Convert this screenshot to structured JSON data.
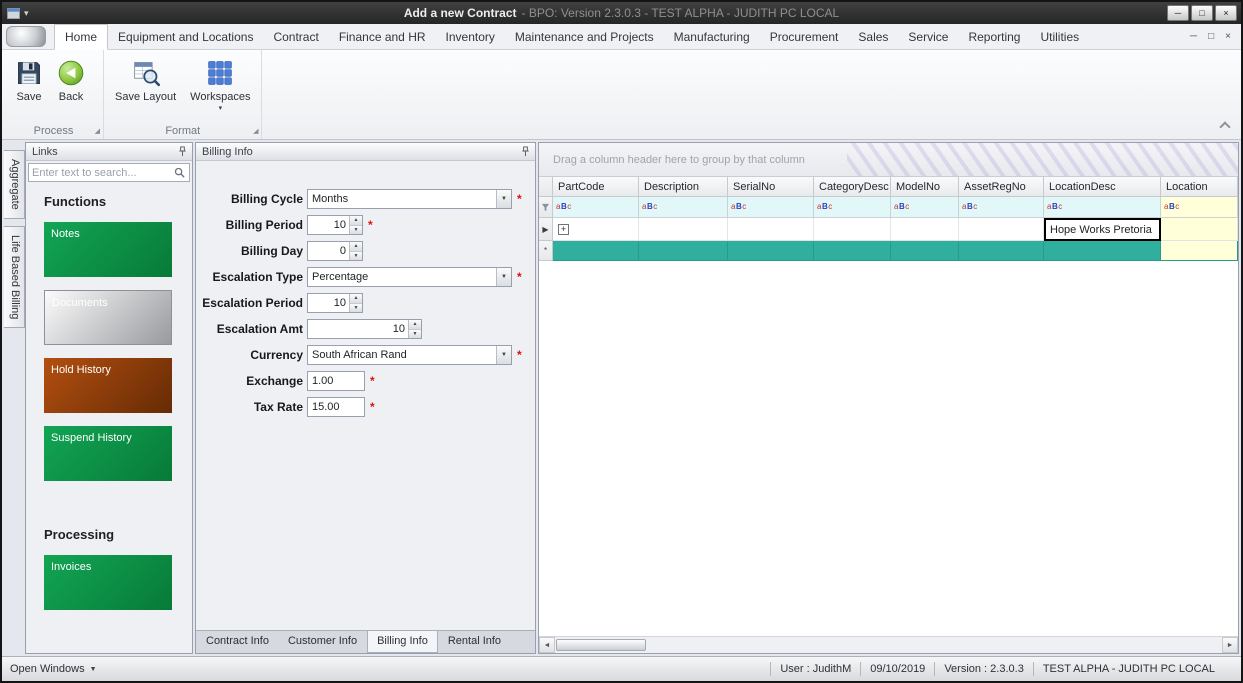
{
  "titlebar": {
    "title": "Add a new Contract",
    "subtitle": "- BPO: Version 2.3.0.3 - TEST ALPHA - JUDITH PC LOCAL"
  },
  "ribbon": {
    "tabs": [
      "Home",
      "Equipment and Locations",
      "Contract",
      "Finance and HR",
      "Inventory",
      "Maintenance and Projects",
      "Manufacturing",
      "Procurement",
      "Sales",
      "Service",
      "Reporting",
      "Utilities"
    ],
    "active_tab": "Home",
    "buttons": {
      "save": "Save",
      "back": "Back",
      "save_layout": "Save Layout",
      "workspaces": "Workspaces"
    },
    "groups": {
      "process": "Process",
      "format": "Format"
    }
  },
  "dock_tabs": [
    "Aggregate",
    "Life Based Billing"
  ],
  "links": {
    "title": "Links",
    "search_placeholder": "Enter text to search...",
    "functions_heading": "Functions",
    "processing_heading": "Processing",
    "function_buttons": [
      {
        "label": "Notes"
      },
      {
        "label": "Documents"
      },
      {
        "label": "Hold History"
      },
      {
        "label": "Suspend History"
      }
    ],
    "processing_buttons": [
      {
        "label": "Invoices"
      }
    ]
  },
  "billing": {
    "title": "Billing Info",
    "required_marker": "*",
    "fields": {
      "billing_cycle": {
        "label": "Billing Cycle",
        "value": "Months"
      },
      "billing_period": {
        "label": "Billing Period",
        "value": "10"
      },
      "billing_day": {
        "label": "Billing Day",
        "value": "0"
      },
      "escalation_type": {
        "label": "Escalation Type",
        "value": "Percentage"
      },
      "escalation_period": {
        "label": "Escalation Period",
        "value": "10"
      },
      "escalation_amt": {
        "label": "Escalation Amt",
        "value": "10"
      },
      "currency": {
        "label": "Currency",
        "value": "South African Rand"
      },
      "exchange": {
        "label": "Exchange",
        "value": "1.00"
      },
      "tax_rate": {
        "label": "Tax Rate",
        "value": "15.00"
      }
    },
    "tabs": [
      "Contract Info",
      "Customer Info",
      "Billing Info",
      "Rental Info"
    ],
    "active_tab": "Billing Info"
  },
  "grid": {
    "group_hint": "Drag a column header here to group by that column",
    "columns": [
      "PartCode",
      "Description",
      "SerialNo",
      "CategoryDesc",
      "ModelNo",
      "AssetRegNo",
      "LocationDesc",
      "Location"
    ],
    "filter_glyph": {
      "a": "a",
      "b": "B",
      "c": "c"
    },
    "focused_cell_value": "Hope Works Pretoria"
  },
  "statusbar": {
    "open_windows": "Open Windows",
    "user": "User : JudithM",
    "date": "09/10/2019",
    "version": "Version : 2.3.0.3",
    "environment": "TEST ALPHA - JUDITH PC LOCAL"
  },
  "icons": {
    "qat_caret": "▾",
    "minimize": "─",
    "restore": "□",
    "close": "×",
    "dropdown": "▼",
    "spin_up": "▲",
    "spin_down": "▼",
    "workspaces_caret": "▾",
    "launcher": "◢",
    "row_arrow": "▶",
    "expand_plus": "+",
    "new_row_star": "*",
    "open_windows_caret": "▼",
    "scroll_left": "◄",
    "scroll_right": "►"
  },
  "colors": {
    "green_light": "#12a554",
    "green_dark": "#077a38",
    "silver_light": "#fbfbfb",
    "silver_dark": "#989a9e",
    "red_light": "#b34f10",
    "red_dark": "#662b05",
    "new_row_teal": "#30ae9e",
    "filter_cyan": "#e2f8f8",
    "location_yellow": "#ffffd9",
    "required": "#e01010"
  }
}
